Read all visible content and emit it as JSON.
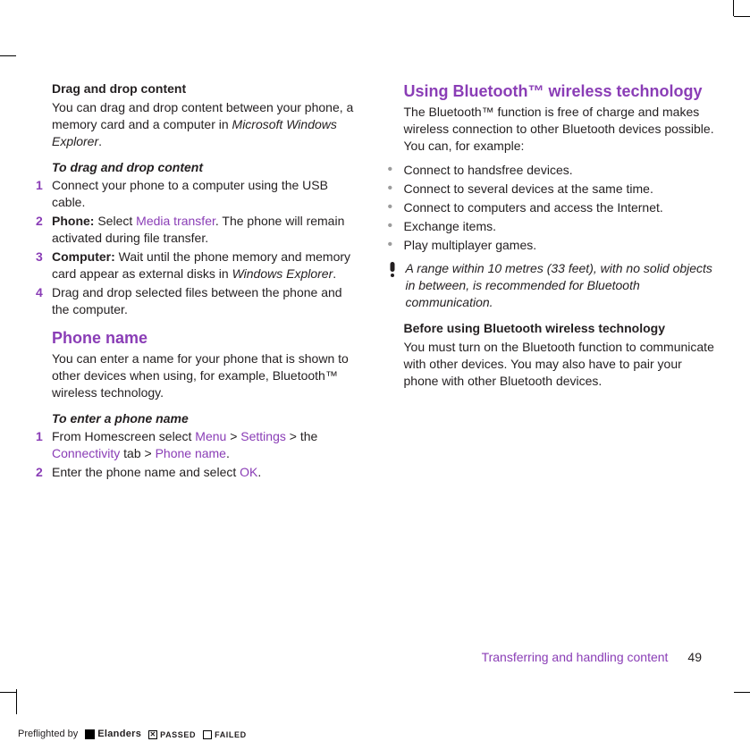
{
  "left": {
    "drag_drop": {
      "title": "Drag and drop content",
      "intro_pre": "You can drag and drop content between your phone, a memory card and a computer in ",
      "intro_italic": "Microsoft Windows Explorer",
      "intro_post": ".",
      "subhead": "To drag and drop content",
      "steps": {
        "s1": "Connect your phone to a computer using the USB cable.",
        "s2_bold": "Phone:",
        "s2_pre": " Select ",
        "s2_menu": "Media transfer",
        "s2_post": ". The phone will remain activated during file transfer.",
        "s3_bold": "Computer:",
        "s3_pre": " Wait until the phone memory and memory card appear as external disks in ",
        "s3_italic": "Windows Explorer",
        "s3_post": ".",
        "s4": "Drag and drop selected files between the phone and the computer."
      }
    },
    "phone_name": {
      "title": "Phone name",
      "intro": "You can enter a name for your phone that is shown to other devices when using, for example, Bluetooth™ wireless technology.",
      "subhead": "To enter a phone name",
      "steps": {
        "s1_pre": "From Homescreen select ",
        "s1_menu": "Menu",
        "s1_sep1": " > ",
        "s1_settings": "Settings",
        "s1_sep2": " > the ",
        "s1_conn": "Connectivity",
        "s1_tab": " tab > ",
        "s1_name": "Phone name",
        "s1_post": ".",
        "s2_pre": "Enter the phone name and select ",
        "s2_ok": "OK",
        "s2_post": "."
      }
    }
  },
  "right": {
    "bt": {
      "title": "Using Bluetooth™ wireless technology",
      "intro": "The Bluetooth™ function is free of charge and makes wireless connection to other Bluetooth devices possible. You can, for example:",
      "bullets": {
        "b1": "Connect to handsfree devices.",
        "b2": "Connect to several devices at the same time.",
        "b3": "Connect to computers and access the Internet.",
        "b4": "Exchange items.",
        "b5": "Play multiplayer games."
      },
      "note": "A range within 10 metres (33 feet), with no solid objects in between, is recommended for Bluetooth communication.",
      "before": {
        "title": "Before using Bluetooth wireless technology",
        "body": "You must turn on the Bluetooth function to communicate with other devices. You may also have to pair your phone with other Bluetooth devices."
      }
    }
  },
  "footer": {
    "section": "Transferring and handling content",
    "page": "49"
  },
  "preflight": {
    "label": "Preflighted by",
    "brand": "Elanders",
    "passed": "PASSED",
    "failed": "FAILED"
  },
  "nums": {
    "n1": "1",
    "n2": "2",
    "n3": "3",
    "n4": "4"
  }
}
